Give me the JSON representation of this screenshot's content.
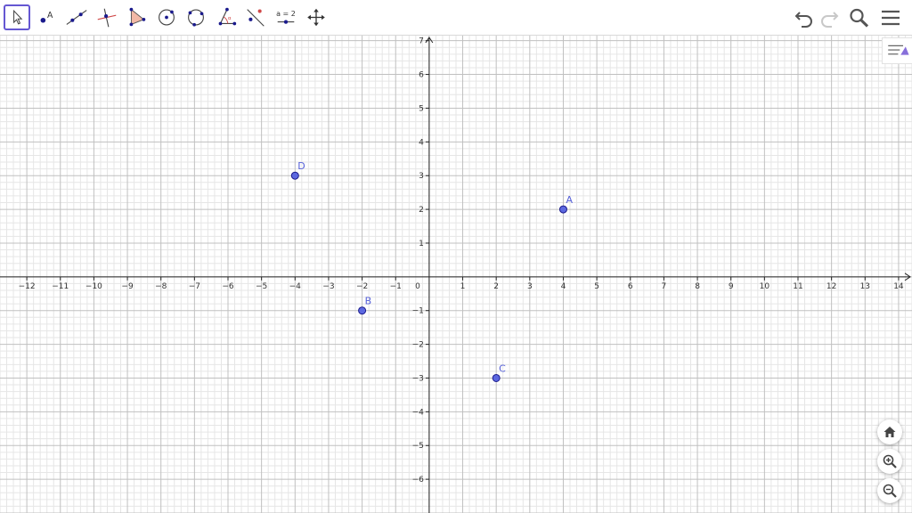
{
  "toolbar": {
    "tools": [
      {
        "name": "move",
        "selected": true
      },
      {
        "name": "point"
      },
      {
        "name": "line"
      },
      {
        "name": "perpendicular-line"
      },
      {
        "name": "polygon"
      },
      {
        "name": "circle-center-point"
      },
      {
        "name": "circle-three-points"
      },
      {
        "name": "angle"
      },
      {
        "name": "reflect"
      },
      {
        "name": "slider",
        "label": "a = 2"
      },
      {
        "name": "move-graphics-view"
      }
    ],
    "right_icons": [
      "undo-icon",
      "redo-icon",
      "search-icon",
      "menu-icon"
    ]
  },
  "graph": {
    "x_range": [
      -12.8,
      14.4
    ],
    "y_range": [
      -7,
      7.15
    ],
    "x_ticks": [
      -12,
      -11,
      -10,
      -9,
      -8,
      -7,
      -6,
      -5,
      -4,
      -3,
      -2,
      -1,
      1,
      2,
      3,
      4,
      5,
      6,
      7,
      8,
      9,
      10,
      11,
      12,
      13,
      14
    ],
    "y_ticks": [
      -6,
      -5,
      -4,
      -3,
      -2,
      -1,
      1,
      2,
      3,
      4,
      5,
      6,
      7
    ],
    "origin_label": "0",
    "minor_per_unit": 5,
    "grid": true,
    "points": [
      {
        "label": "A",
        "x": 4,
        "y": 2
      },
      {
        "label": "B",
        "x": -2,
        "y": -1
      },
      {
        "label": "C",
        "x": 2,
        "y": -3
      },
      {
        "label": "D",
        "x": -4,
        "y": 3
      }
    ],
    "colors": {
      "point_fill": "#5c68e0",
      "point_stroke": "#1a1a8c",
      "point_label": "#5560d8",
      "major_grid": "#c0c0c0",
      "minor_grid": "#e6e6e6",
      "axis": "#252525"
    }
  },
  "zoom_controls": [
    "home-icon",
    "zoom-in-icon",
    "zoom-out-icon"
  ]
}
